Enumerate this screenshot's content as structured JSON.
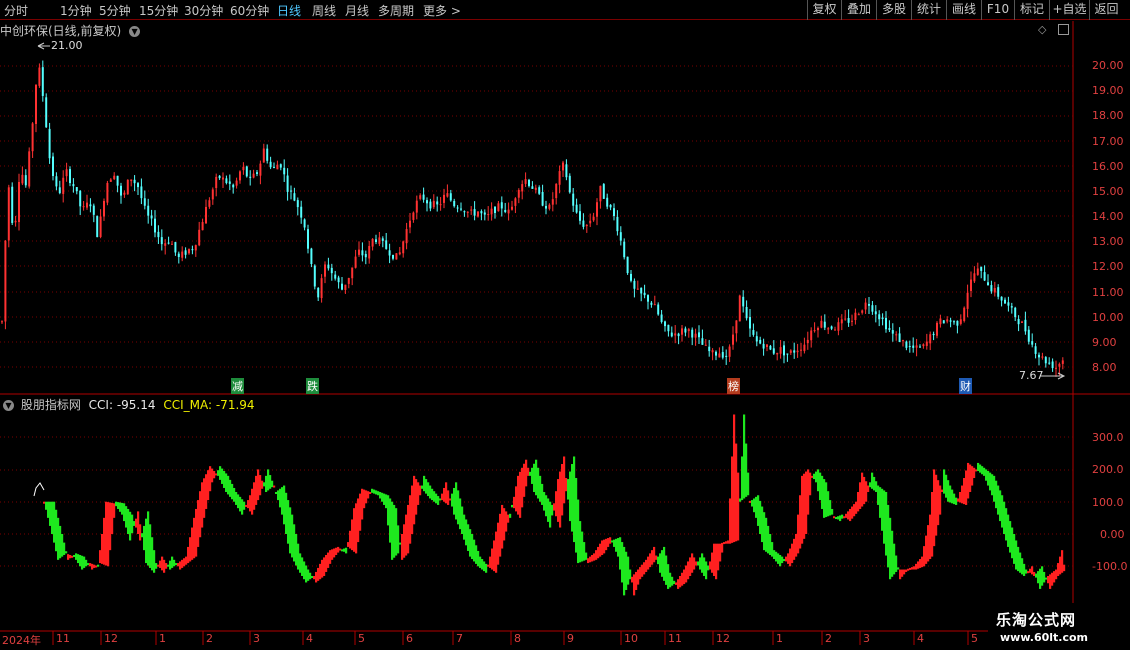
{
  "toolbar": {
    "periods": [
      "分时",
      "1分钟",
      "5分钟",
      "15分钟",
      "30分钟",
      "60分钟",
      "日线",
      "周线",
      "月线",
      "多周期",
      "更多"
    ],
    "active_period": "日线",
    "more_arrow": ">",
    "right_buttons": [
      "复权",
      "叠加",
      "多股",
      "统计",
      "画线",
      "F10",
      "标记",
      "+自选",
      "返回"
    ]
  },
  "price_panel": {
    "title": "中创环保(日线,前复权)",
    "high_label": "21.00",
    "low_label": "7.67",
    "event_markers": [
      "减",
      "跌",
      "榜",
      "财"
    ],
    "axis_ticks": [
      "20.00",
      "19.00",
      "18.00",
      "17.00",
      "16.00",
      "15.00",
      "14.00",
      "13.00",
      "12.00",
      "11.00",
      "10.00",
      "9.00",
      "8.00"
    ]
  },
  "indicator_panel": {
    "name": "股朋指标网",
    "cci_label": "CCI: -95.14",
    "cci_ma_label": "CCI_MA: -71.94",
    "axis_ticks": [
      "300.0",
      "200.0",
      "100.0",
      "0.00",
      "-100.0"
    ]
  },
  "time_axis": {
    "year_label": "2024年",
    "month_labels": [
      "11",
      "12",
      "1",
      "2",
      "3",
      "4",
      "5",
      "6",
      "7",
      "8",
      "9",
      "10",
      "11",
      "12",
      "1",
      "2",
      "3",
      "4",
      "5"
    ]
  },
  "watermark": {
    "line1": "乐淘公式网",
    "line2": "www.60lt.com"
  },
  "colors": {
    "up": "#ff3232",
    "down": "#54ffff",
    "cci_up": "#ff2020",
    "cci_down": "#1ee81e",
    "grid": "#7a0000",
    "cci_ma_text": "#f0f000",
    "active": "#4fc8ff"
  },
  "icons": {
    "panel_menu": "chevron-down-circle-icon",
    "diamond": "diamond-icon",
    "panel_toggle": "panel-toggle-icon"
  }
}
